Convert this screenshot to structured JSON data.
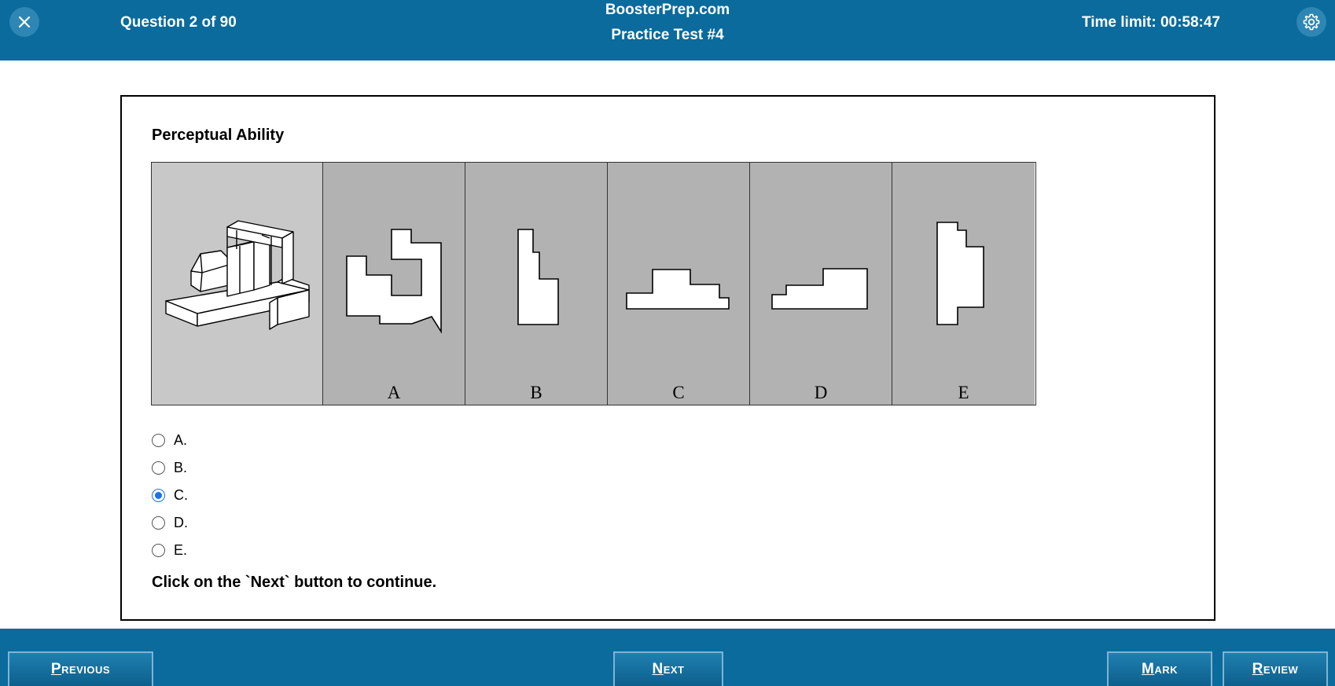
{
  "header": {
    "question_counter": "Question 2 of 90",
    "brand": "BoosterPrep.com",
    "test_name": "Practice Test #4",
    "time_limit": "Time limit: 00:58:47",
    "close_icon": "close-icon",
    "settings_icon": "gear-icon"
  },
  "question": {
    "section_title": "Perceptual Ability",
    "figure_letters": [
      "A",
      "B",
      "C",
      "D",
      "E"
    ],
    "choices": [
      {
        "label": "A.",
        "checked": false
      },
      {
        "label": "B.",
        "checked": false
      },
      {
        "label": "C.",
        "checked": true
      },
      {
        "label": "D.",
        "checked": false
      },
      {
        "label": "E.",
        "checked": false
      }
    ],
    "instruction": "Click on the `Next` button to continue."
  },
  "footer": {
    "previous": {
      "first": "P",
      "rest": "revious"
    },
    "next": {
      "first": "N",
      "rest": "ext"
    },
    "mark": {
      "first": "M",
      "rest": "ark"
    },
    "review": {
      "first": "R",
      "rest": "eview"
    }
  },
  "colors": {
    "bar": "#0a6b9c",
    "accent": "#1a73e8",
    "main_figure_bg": "#c8c8c8",
    "option_bg": "#b2b2b2"
  }
}
